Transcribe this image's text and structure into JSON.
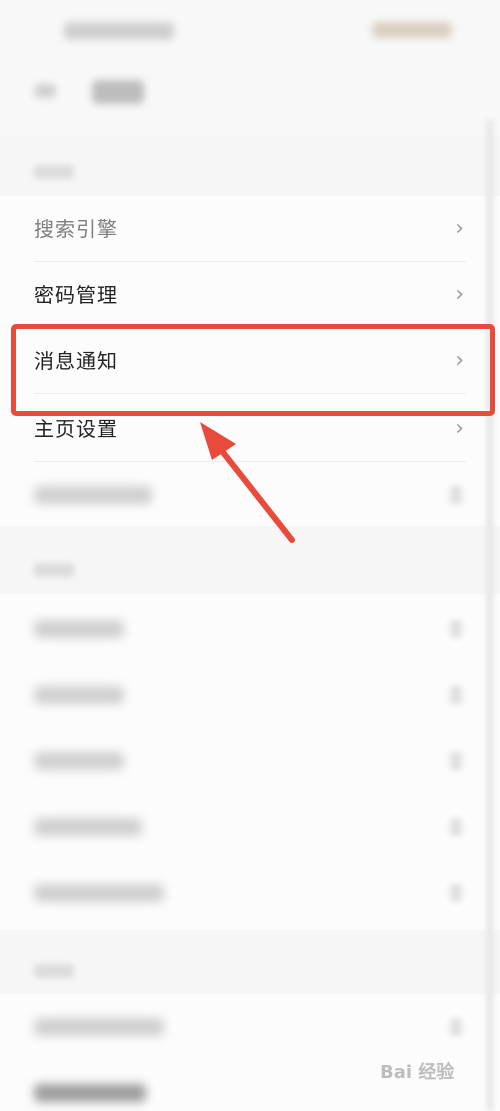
{
  "settings": {
    "items": [
      {
        "label": "搜索引擎"
      },
      {
        "label": "密码管理"
      },
      {
        "label": "消息通知"
      },
      {
        "label": "主页设置"
      }
    ],
    "chevron": "›"
  },
  "colors": {
    "highlight": "#e84a3b",
    "arrow": "#e84a3b"
  },
  "watermark": {
    "text": "Bai 经验"
  }
}
